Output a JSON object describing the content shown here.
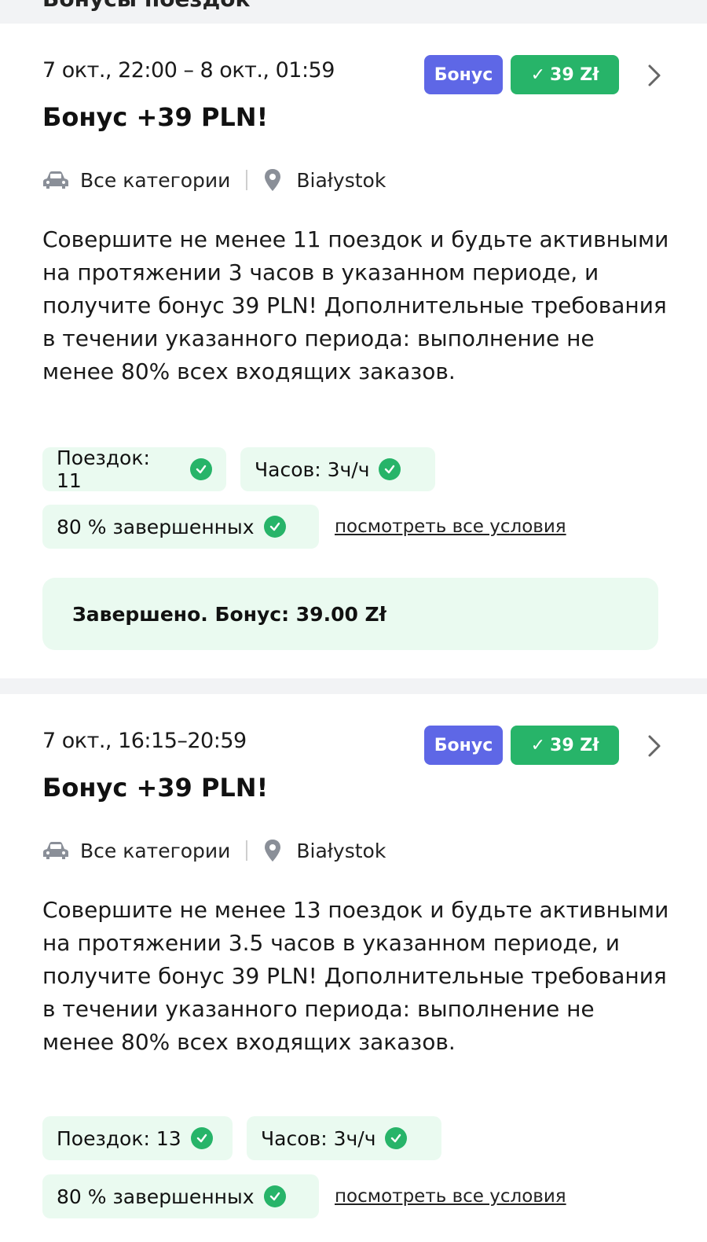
{
  "header": {
    "partial_title": "Бонусы поездок"
  },
  "cards": [
    {
      "date": "7 окт., 22:00 – 8 окт., 01:59",
      "badge_type": "Бонус",
      "badge_check": "✓",
      "badge_amount": "39 Zł",
      "title": "Бонус +39 PLN!",
      "category": "Все категории",
      "city": "Białystok",
      "description": "Совершите не менее 11 поездок и будьте активными на протяжении 3 часов в указанном периоде, и получите бонус 39 PLN! Дополнительные требования в течении указанного периода: выполнение не менее 80% всех входящих заказов.",
      "chips": [
        "Поездок: 11",
        "Часов: 3ч/ч",
        "80 % завершенных"
      ],
      "link": "посмотреть все условия",
      "status": "Завершено. Бонус: 39.00 Zł"
    },
    {
      "date": "7 окт., 16:15–20:59",
      "badge_type": "Бонус",
      "badge_check": "✓",
      "badge_amount": "39 Zł",
      "title": "Бонус +39 PLN!",
      "category": "Все категории",
      "city": "Białystok",
      "description": "Совершите не менее 13 поездок и будьте активными на протяжении 3.5 часов в указанном периоде, и получите бонус 39 PLN! Дополнительные требования в течении указанного периода: выполнение не менее 80% всех входящих заказов.",
      "chips": [
        "Поездок: 13",
        "Часов: 3ч/ч",
        "80 % завершенных"
      ],
      "link": "посмотреть все условия"
    }
  ],
  "colors": {
    "bonus_badge": "#5e67e6",
    "amount_badge": "#27b469",
    "chip_bg": "#eafaf0",
    "check": "#27b469"
  },
  "icons": {
    "chevron": "chevron-right-icon",
    "car": "car-icon",
    "pin": "location-pin-icon",
    "check": "check-circle-icon"
  }
}
